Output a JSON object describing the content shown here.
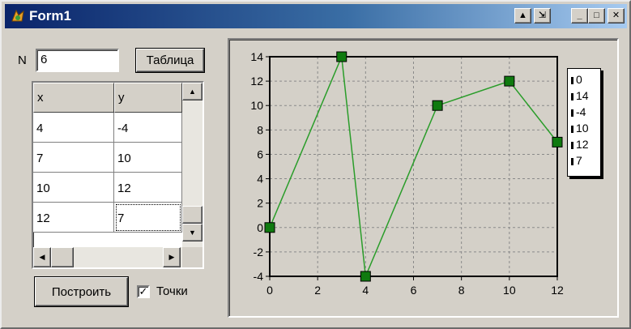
{
  "window": {
    "title": "Form1"
  },
  "form": {
    "n_label": "N",
    "n_value": "6",
    "table_button": "Таблица",
    "build_button": "Построить",
    "points_label": "Точки",
    "points_checked": true
  },
  "grid": {
    "headers": [
      "x",
      "y"
    ],
    "rows": [
      [
        "4",
        "-4"
      ],
      [
        "7",
        "10"
      ],
      [
        "10",
        "12"
      ],
      [
        "12",
        "7"
      ]
    ]
  },
  "chart_data": {
    "type": "line",
    "x": [
      0,
      3,
      4,
      7,
      10,
      12
    ],
    "y": [
      0,
      14,
      -4,
      10,
      12,
      7
    ],
    "xlim": [
      0,
      12
    ],
    "ylim": [
      -4,
      14
    ],
    "xticks": [
      "0",
      "2",
      "4",
      "6",
      "8",
      "10",
      "12"
    ],
    "yticks": [
      "14",
      "12",
      "10",
      "8",
      "6",
      "4",
      "2",
      "0",
      "-2",
      "-4"
    ],
    "grid": true,
    "legend_position": "right",
    "legend": [
      "0",
      "14",
      "-4",
      "10",
      "12",
      "7"
    ],
    "line_color": "#2a9d2a",
    "marker_color": "#0f7a0f"
  }
}
